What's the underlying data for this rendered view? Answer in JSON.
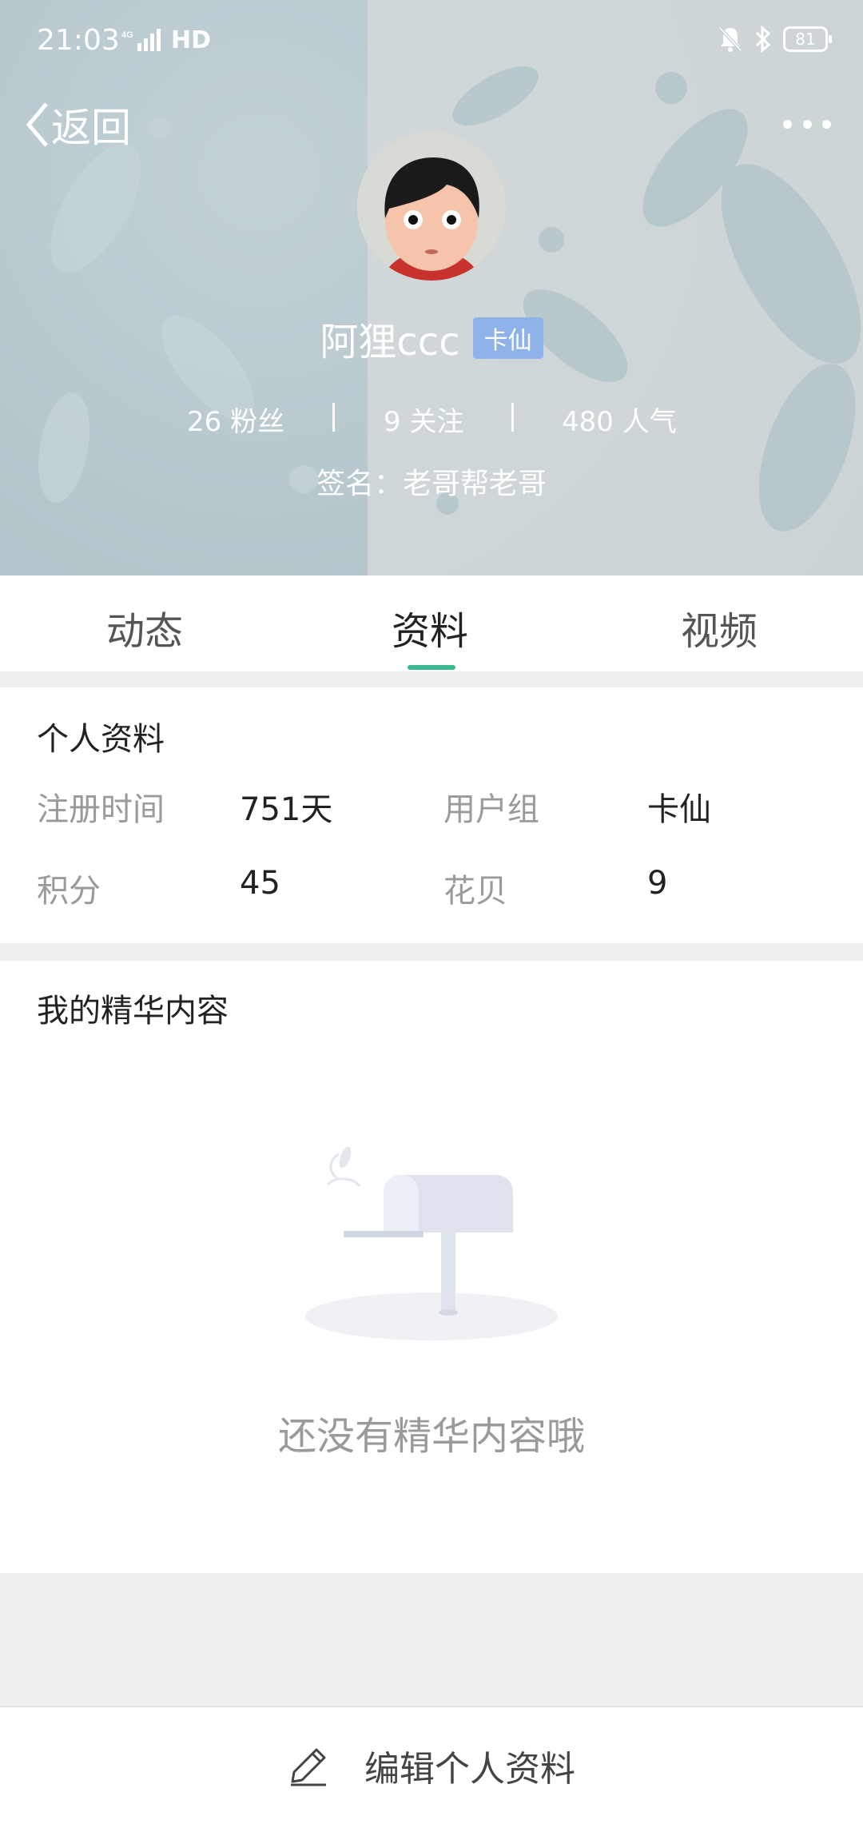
{
  "status_bar": {
    "time": "21:03",
    "network": "HD",
    "network_type": "4G",
    "battery": "81"
  },
  "nav": {
    "back_label": "返回"
  },
  "profile": {
    "name": "阿狸ccc",
    "badge": "卡仙",
    "stats": [
      {
        "value": "26",
        "label": "粉丝"
      },
      {
        "value": "9",
        "label": "关注"
      },
      {
        "value": "480",
        "label": "人气"
      }
    ],
    "signature": "签名：老哥帮老哥"
  },
  "tabs": [
    {
      "label": "动态",
      "active": false
    },
    {
      "label": "资料",
      "active": true
    },
    {
      "label": "视频",
      "active": false
    }
  ],
  "personal_info": {
    "title": "个人资料",
    "rows": [
      {
        "label1": "注册时间",
        "value1": "751天",
        "label2": "用户组",
        "value2": "卡仙"
      },
      {
        "label1": "积分",
        "value1": "45",
        "label2": "花贝",
        "value2": "9"
      }
    ]
  },
  "featured": {
    "title": "我的精华内容",
    "empty_text": "还没有精华内容哦"
  },
  "bottom": {
    "edit_label": "编辑个人资料"
  },
  "colors": {
    "accent": "#3db892",
    "badge": "#8fb3e8",
    "header_bg": "#b7c8cd"
  }
}
